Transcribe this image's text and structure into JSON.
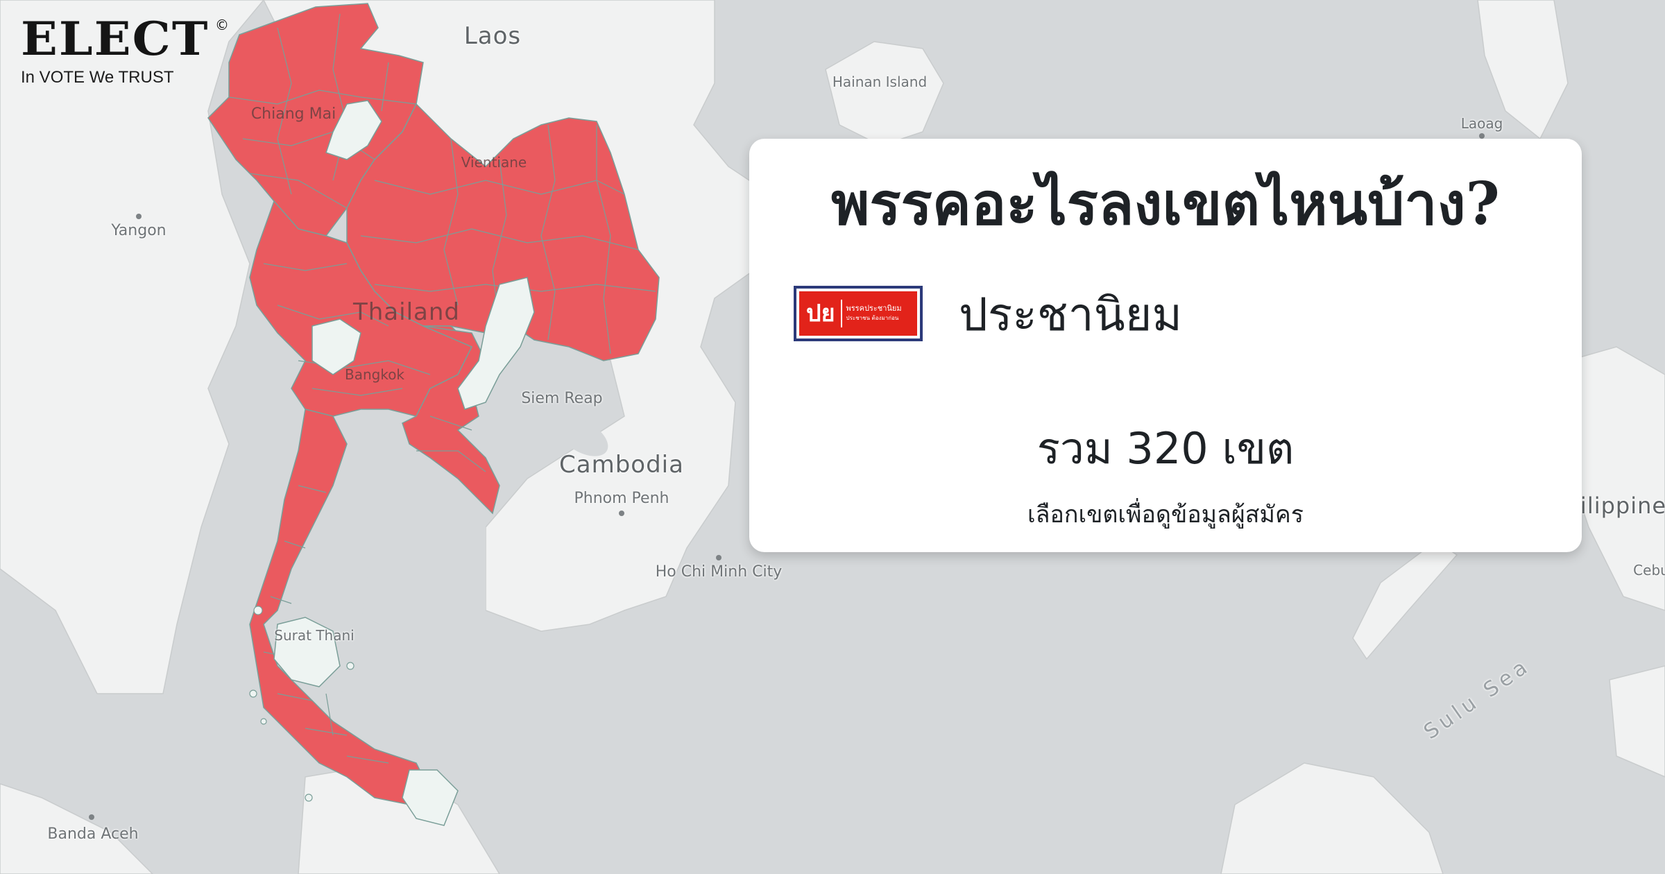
{
  "brand": {
    "logo": "ELECT",
    "registered_mark": "©",
    "tagline": "In VOTE We TRUST"
  },
  "map": {
    "labels": {
      "laos": "Laos",
      "hainan": "Hainan Island",
      "laoag": "Laoag",
      "yangon": "Yangon",
      "chiang_mai": "Chiang Mai",
      "vientiane": "Vientiane",
      "thailand": "Thailand",
      "bangkok": "Bangkok",
      "siem_reap": "Siem Reap",
      "cambodia": "Cambodia",
      "phnom_penh": "Phnom Penh",
      "ho_chi_minh": "Ho Chi Minh City",
      "surat_thani": "Surat Thani",
      "banda_aceh": "Banda Aceh",
      "philippines": "ilippine",
      "cebu": "Cebu",
      "sulu_sea": "Sulu Sea"
    },
    "colors": {
      "water": "#d5d8da",
      "land": "#f1f2f2",
      "contested_district": "#ea5a5f",
      "uncontested_district": "#eef4f2",
      "district_border": "#7a9e98"
    }
  },
  "card": {
    "title": "พรรคอะไรลงเขตไหนบ้าง?",
    "party": {
      "logo_abbr": "ปย",
      "logo_text": "พรรคประชานิยม",
      "logo_subtext": "ประชาชน ต้องมาก่อน",
      "name": "ประชานิยม",
      "brand_color": "#e2231a"
    },
    "total_districts": "รวม 320 เขต",
    "hint": "เลือกเขตเพื่อดูข้อมูลผู้สมัคร"
  }
}
